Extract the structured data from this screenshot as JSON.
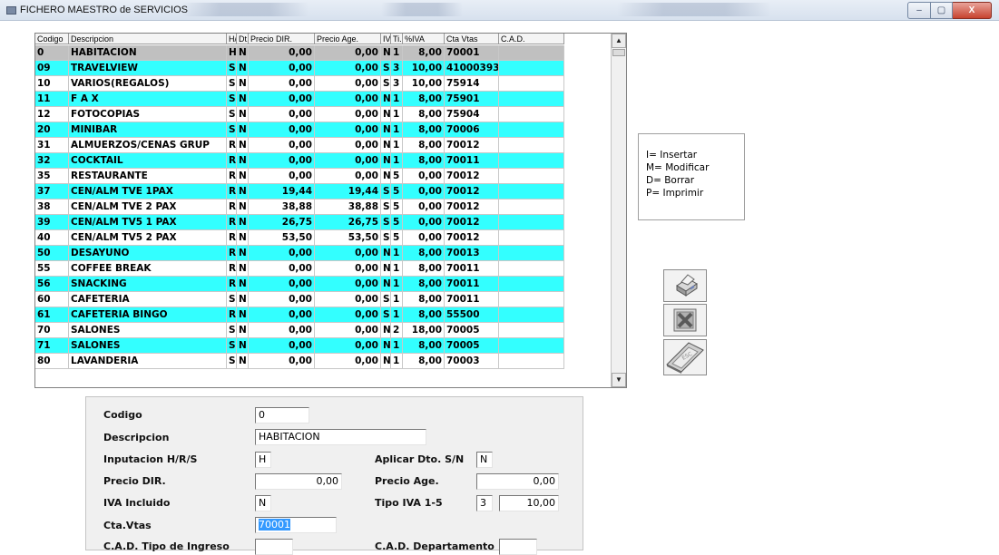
{
  "window": {
    "title": "FICHERO MAESTRO de SERVICIOS",
    "controls": {
      "minimize": "–",
      "maximize": "▢",
      "close": "X"
    }
  },
  "grid": {
    "columns": [
      "Codigo",
      "Descripcion",
      "H/",
      "Dt.",
      "Precio DIR.",
      "Precio Age.",
      "IV.",
      "Ti.",
      "%IVA",
      "Cta Vtas",
      "C.A.D."
    ],
    "rows": [
      [
        "0",
        "HABITACION",
        "H",
        "N",
        "0,00",
        "0,00",
        "N",
        "1",
        "8,00",
        "70001",
        ""
      ],
      [
        "09",
        "TRAVELVIEW",
        "S",
        "N",
        "0,00",
        "0,00",
        "S",
        "3",
        "10,00",
        "41000393",
        ""
      ],
      [
        "10",
        "VARIOS(REGALOS)",
        "S",
        "N",
        "0,00",
        "0,00",
        "S",
        "3",
        "10,00",
        "75914",
        ""
      ],
      [
        "11",
        "F A X",
        "S",
        "N",
        "0,00",
        "0,00",
        "N",
        "1",
        "8,00",
        "75901",
        ""
      ],
      [
        "12",
        "FOTOCOPIAS",
        "S",
        "N",
        "0,00",
        "0,00",
        "N",
        "1",
        "8,00",
        "75904",
        ""
      ],
      [
        "20",
        "MINIBAR",
        "S",
        "N",
        "0,00",
        "0,00",
        "N",
        "1",
        "8,00",
        "70006",
        ""
      ],
      [
        "31",
        "ALMUERZOS/CENAS GRUP",
        "R",
        "N",
        "0,00",
        "0,00",
        "N",
        "1",
        "8,00",
        "70012",
        ""
      ],
      [
        "32",
        "COCKTAIL",
        "R",
        "N",
        "0,00",
        "0,00",
        "N",
        "1",
        "8,00",
        "70011",
        ""
      ],
      [
        "35",
        "RESTAURANTE",
        "R",
        "N",
        "0,00",
        "0,00",
        "N",
        "5",
        "0,00",
        "70012",
        ""
      ],
      [
        "37",
        "CEN/ALM TVE 1PAX",
        "R",
        "N",
        "19,44",
        "19,44",
        "S",
        "5",
        "0,00",
        "70012",
        ""
      ],
      [
        "38",
        "CEN/ALM TVE 2 PAX",
        "R",
        "N",
        "38,88",
        "38,88",
        "S",
        "5",
        "0,00",
        "70012",
        ""
      ],
      [
        "39",
        "CEN/ALM TV5 1 PAX",
        "R",
        "N",
        "26,75",
        "26,75",
        "S",
        "5",
        "0,00",
        "70012",
        ""
      ],
      [
        "40",
        "CEN/ALM TV5 2 PAX",
        "R",
        "N",
        "53,50",
        "53,50",
        "S",
        "5",
        "0,00",
        "70012",
        ""
      ],
      [
        "50",
        "DESAYUNO",
        "R",
        "N",
        "0,00",
        "0,00",
        "N",
        "1",
        "8,00",
        "70013",
        ""
      ],
      [
        "55",
        "COFFEE BREAK",
        "R",
        "N",
        "0,00",
        "0,00",
        "N",
        "1",
        "8,00",
        "70011",
        ""
      ],
      [
        "56",
        "SNACKING",
        "R",
        "N",
        "0,00",
        "0,00",
        "N",
        "1",
        "8,00",
        "70011",
        ""
      ],
      [
        "60",
        "CAFETERIA",
        "S",
        "N",
        "0,00",
        "0,00",
        "S",
        "1",
        "8,00",
        "70011",
        ""
      ],
      [
        "61",
        "CAFETERIA BINGO",
        "R",
        "N",
        "0,00",
        "0,00",
        "S",
        "1",
        "8,00",
        "55500",
        ""
      ],
      [
        "70",
        "SALONES",
        "S",
        "N",
        "0,00",
        "0,00",
        "N",
        "2",
        "18,00",
        "70005",
        ""
      ],
      [
        "71",
        "SALONES",
        "S",
        "N",
        "0,00",
        "0,00",
        "N",
        "1",
        "8,00",
        "70005",
        ""
      ],
      [
        "80",
        "LAVANDERIA",
        "S",
        "N",
        "0,00",
        "0,00",
        "N",
        "1",
        "8,00",
        "70003",
        ""
      ]
    ],
    "selected_row": 0,
    "colors": {
      "alt_row": "#33ffff",
      "selected_row": "#c0c0c0"
    }
  },
  "legend": {
    "items": [
      "I= Insertar",
      "M= Modificar",
      "D= Borrar",
      "P= Imprimir"
    ]
  },
  "actions": {
    "icons": [
      "printer-icon",
      "excel-icon",
      "exit-key-icon"
    ]
  },
  "form": {
    "codigo": {
      "label": "Codigo",
      "value": "0"
    },
    "descripcion": {
      "label": "Descripcion",
      "value": "HABITACION"
    },
    "inputacion": {
      "label": "Inputacion H/R/S",
      "value": "H"
    },
    "aplicar_dto": {
      "label": "Aplicar Dto. S/N",
      "value": "N"
    },
    "precio_dir": {
      "label": "Precio DIR.",
      "value": "0,00"
    },
    "precio_age": {
      "label": "Precio Age.",
      "value": "0,00"
    },
    "iva_incluido": {
      "label": "IVA Incluido",
      "value": "N"
    },
    "tipo_iva": {
      "label": "Tipo IVA 1-5",
      "value": "3",
      "percent": "10,00"
    },
    "cta_vtas": {
      "label": "Cta.Vtas",
      "value": "70001"
    },
    "cad_ingreso": {
      "label": "C.A.D. Tipo de Ingreso",
      "value": ""
    },
    "cad_departamento": {
      "label": "C.A.D. Departamento",
      "value": ""
    }
  }
}
